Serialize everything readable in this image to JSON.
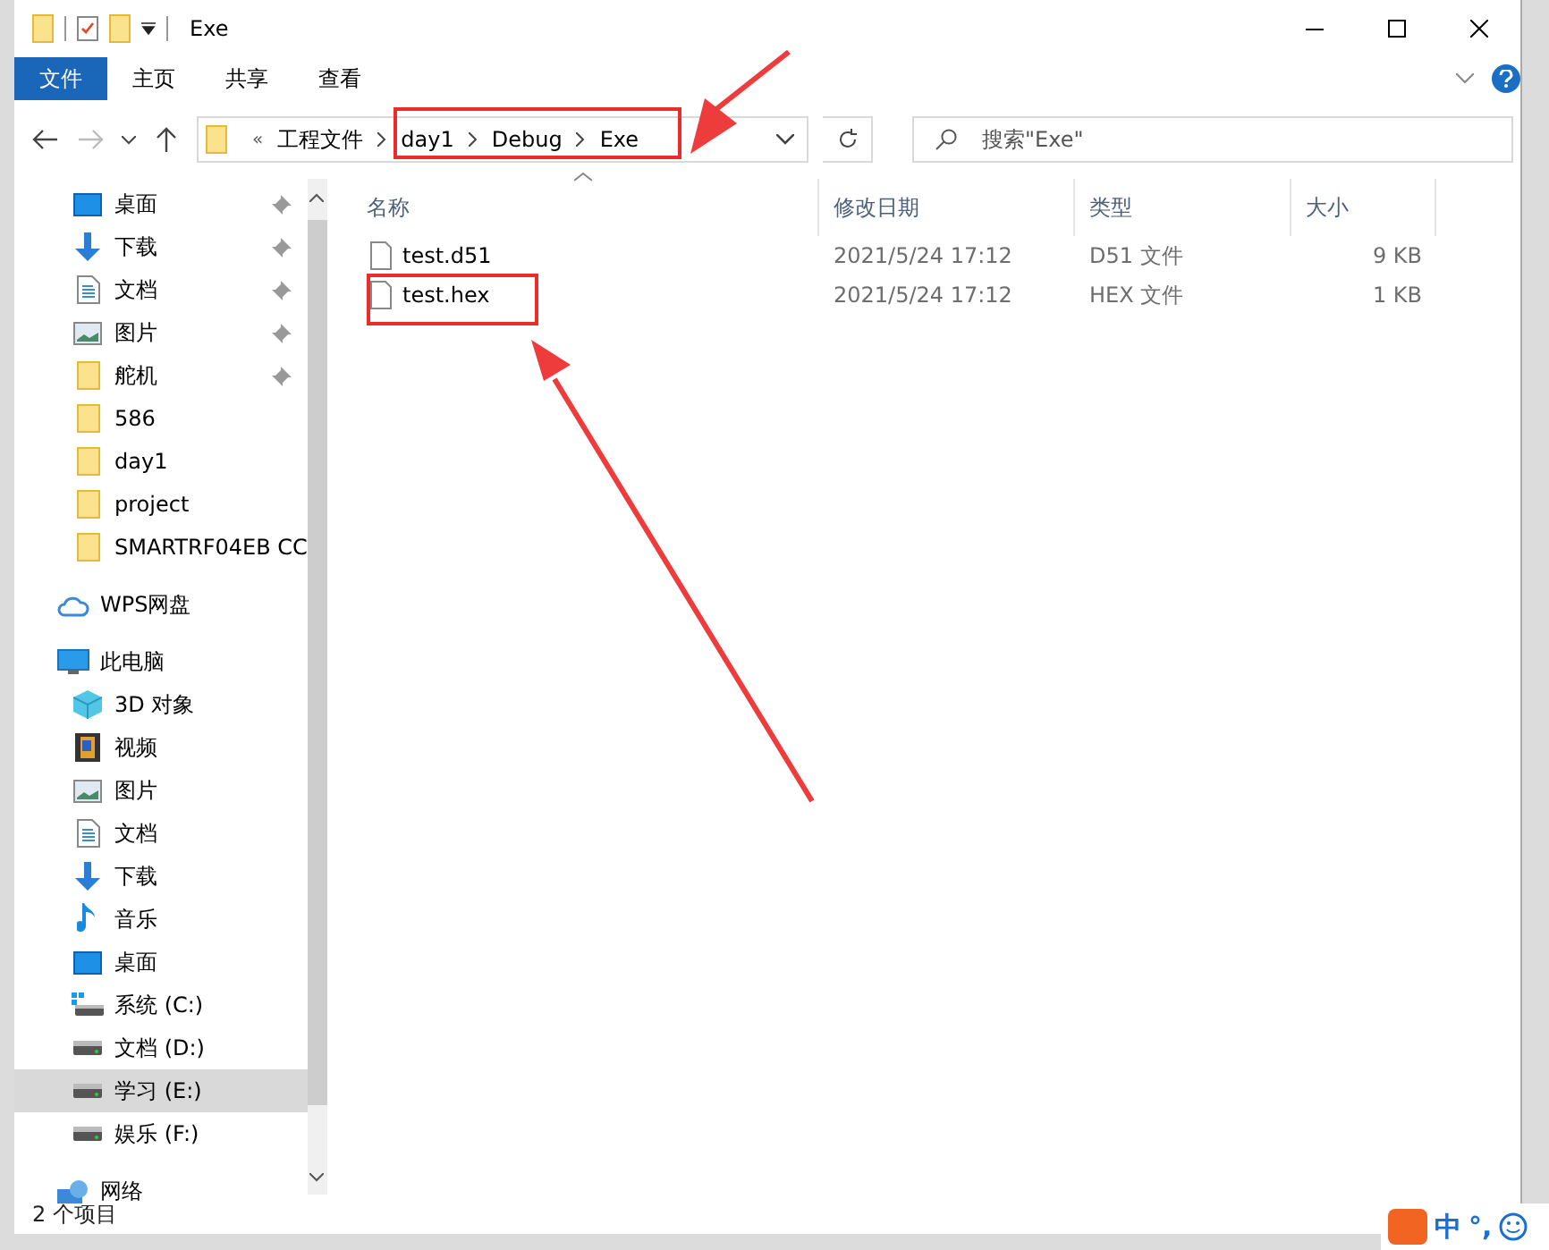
{
  "window": {
    "title": "Exe"
  },
  "ribbon_tabs": [
    {
      "label": "文件",
      "selected": true
    },
    {
      "label": "主页",
      "selected": false
    },
    {
      "label": "共享",
      "selected": false
    },
    {
      "label": "查看",
      "selected": false
    }
  ],
  "address": {
    "overflow": "«",
    "crumbs": [
      "工程文件",
      "day1",
      "Debug",
      "Exe"
    ]
  },
  "search": {
    "placeholder": "搜索\"Exe\""
  },
  "sidebar": {
    "items": [
      {
        "label": "桌面",
        "kind": "desktop",
        "pinned": true,
        "selected": false
      },
      {
        "label": "下载",
        "kind": "download",
        "pinned": true,
        "selected": false
      },
      {
        "label": "文档",
        "kind": "document",
        "pinned": true,
        "selected": false
      },
      {
        "label": "图片",
        "kind": "picture",
        "pinned": true,
        "selected": false
      },
      {
        "label": "舵机",
        "kind": "folder",
        "pinned": true,
        "selected": false
      },
      {
        "label": "586",
        "kind": "folder",
        "pinned": false,
        "selected": false
      },
      {
        "label": "day1",
        "kind": "folder",
        "pinned": false,
        "selected": false
      },
      {
        "label": "project",
        "kind": "folder",
        "pinned": false,
        "selected": false
      },
      {
        "label": "SMARTRF04EB CC",
        "kind": "folder",
        "pinned": false,
        "selected": false
      },
      {
        "label": "WPS网盘",
        "kind": "cloud",
        "pinned": false,
        "selected": false,
        "top": true
      },
      {
        "label": "此电脑",
        "kind": "pc",
        "pinned": false,
        "selected": false,
        "top": true,
        "children": [
          {
            "label": "3D 对象",
            "kind": "cube",
            "pinned": false,
            "selected": false
          },
          {
            "label": "视频",
            "kind": "video",
            "pinned": false,
            "selected": false
          },
          {
            "label": "图片",
            "kind": "picture",
            "pinned": false,
            "selected": false
          },
          {
            "label": "文档",
            "kind": "document",
            "pinned": false,
            "selected": false
          },
          {
            "label": "下载",
            "kind": "download",
            "pinned": false,
            "selected": false
          },
          {
            "label": "音乐",
            "kind": "music",
            "pinned": false,
            "selected": false
          },
          {
            "label": "桌面",
            "kind": "desktop",
            "pinned": false,
            "selected": false
          },
          {
            "label": "系统 (C:)",
            "kind": "system_drive",
            "pinned": false,
            "selected": false
          },
          {
            "label": "文档 (D:)",
            "kind": "drive",
            "pinned": false,
            "selected": false
          },
          {
            "label": "学习 (E:)",
            "kind": "drive",
            "pinned": false,
            "selected": true
          },
          {
            "label": "娱乐 (F:)",
            "kind": "drive",
            "pinned": false,
            "selected": false
          }
        ]
      },
      {
        "label": "网络",
        "kind": "network",
        "pinned": false,
        "selected": false,
        "top": true
      }
    ]
  },
  "table": {
    "columns": [
      "名称",
      "修改日期",
      "类型",
      "大小"
    ],
    "rows": [
      {
        "name": "test.d51",
        "modified": "2021/5/24 17:12",
        "type": "D51 文件",
        "size": "9 KB",
        "highlighted": false
      },
      {
        "name": "test.hex",
        "modified": "2021/5/24 17:12",
        "type": "HEX 文件",
        "size": "1 KB",
        "highlighted": true
      }
    ]
  },
  "status_bar": {
    "count": "2 个项目"
  },
  "ime_bar": {
    "mode": "中",
    "punctuation": "°,"
  }
}
